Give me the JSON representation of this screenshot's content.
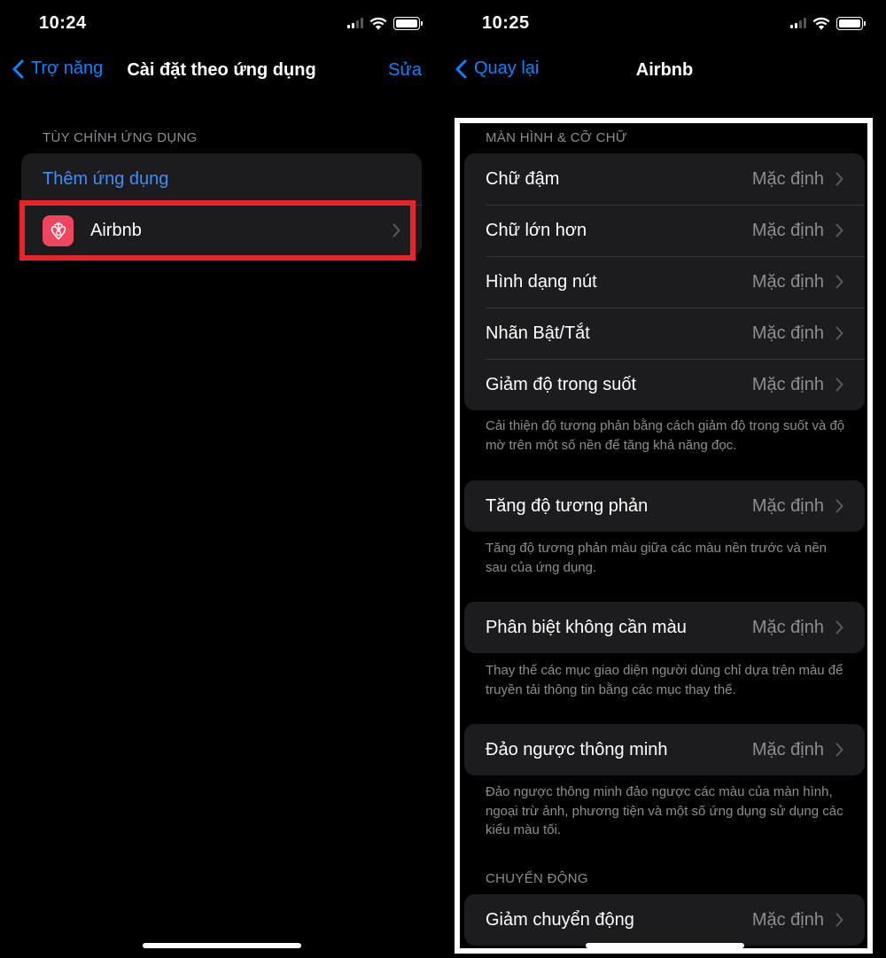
{
  "left": {
    "status_time": "10:24",
    "nav": {
      "back_label": "Trợ năng",
      "title": "Cài đặt theo ứng dụng",
      "edit_label": "Sửa"
    },
    "section_header": "TÙY CHỈNH ỨNG DỤNG",
    "add_app_label": "Thêm ứng dụng",
    "app_item": {
      "label": "Airbnb",
      "icon": "airbnb-icon",
      "icon_color": "#f0455e"
    },
    "highlight_color": "#e8232b"
  },
  "right": {
    "status_time": "10:25",
    "nav": {
      "back_label": "Quay lại",
      "title": "Airbnb"
    },
    "display_header": "MÀN HÌNH & CỠ CHỮ",
    "display_items": [
      {
        "label": "Chữ đậm",
        "value": "Mặc định"
      },
      {
        "label": "Chữ lớn hơn",
        "value": "Mặc định"
      },
      {
        "label": "Hình dạng nút",
        "value": "Mặc định"
      },
      {
        "label": "Nhãn Bật/Tắt",
        "value": "Mặc định"
      },
      {
        "label": "Giảm độ trong suốt",
        "value": "Mặc định"
      }
    ],
    "display_footer": "Cải thiện độ tương phản bằng cách giảm độ trong suốt và độ mờ trên một số nền để tăng khả năng đọc.",
    "contrast": {
      "label": "Tăng độ tương phản",
      "value": "Mặc định",
      "footer": "Tăng độ tương phản màu giữa các màu nền trước và nền sau của ứng dụng."
    },
    "differentiate": {
      "label": "Phân biệt không cần màu",
      "value": "Mặc định",
      "footer": "Thay thế các mục giao diện người dùng chỉ dựa trên màu để truyền tải thông tin bằng các mục thay thế."
    },
    "smart_invert": {
      "label": "Đảo ngược thông minh",
      "value": "Mặc định",
      "footer": "Đảo ngược thông minh đảo ngược các màu của màn hình, ngoại trừ ảnh, phương tiện và một số ứng dụng sử dụng các kiểu màu tối."
    },
    "motion_header": "CHUYỂN ĐỘNG",
    "reduce_motion": {
      "label": "Giảm chuyển động",
      "value": "Mặc định"
    }
  },
  "colors": {
    "accent": "#0a84ff",
    "cell_bg": "#1c1c1e",
    "secondary_text": "#8d8d93"
  }
}
